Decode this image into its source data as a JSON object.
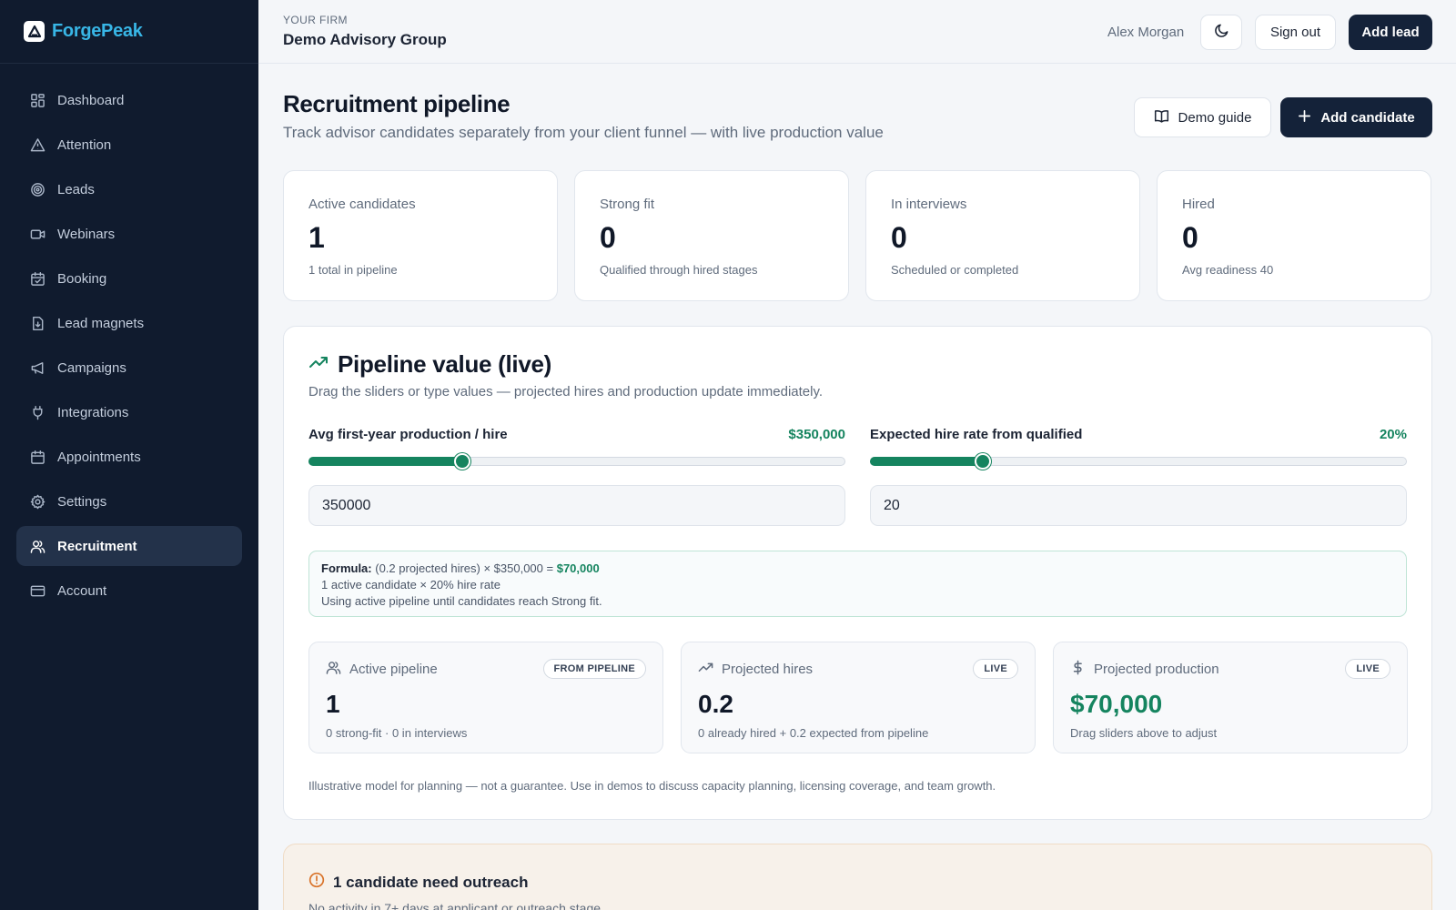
{
  "brand": {
    "name": "ForgePeak"
  },
  "sidebar": {
    "items": [
      {
        "label": "Dashboard",
        "icon": "dashboard-icon"
      },
      {
        "label": "Attention",
        "icon": "warning-icon"
      },
      {
        "label": "Leads",
        "icon": "target-icon"
      },
      {
        "label": "Webinars",
        "icon": "video-icon"
      },
      {
        "label": "Booking",
        "icon": "calendar-check-icon"
      },
      {
        "label": "Lead magnets",
        "icon": "file-download-icon"
      },
      {
        "label": "Campaigns",
        "icon": "megaphone-icon"
      },
      {
        "label": "Integrations",
        "icon": "plug-icon"
      },
      {
        "label": "Appointments",
        "icon": "calendar-icon"
      },
      {
        "label": "Settings",
        "icon": "gear-icon"
      },
      {
        "label": "Recruitment",
        "icon": "users-icon",
        "active": true
      },
      {
        "label": "Account",
        "icon": "credit-card-icon"
      }
    ]
  },
  "topbar": {
    "firm_label": "YOUR FIRM",
    "firm_name": "Demo Advisory Group",
    "user_name": "Alex Morgan",
    "sign_out": "Sign out",
    "add_lead": "Add lead"
  },
  "header": {
    "title": "Recruitment pipeline",
    "subtitle": "Track advisor candidates separately from your client funnel — with live production value",
    "demo_guide": "Demo guide",
    "add_candidate": "Add candidate"
  },
  "stats": [
    {
      "label": "Active candidates",
      "value": "1",
      "sub": "1 total in pipeline"
    },
    {
      "label": "Strong fit",
      "value": "0",
      "sub": "Qualified through hired stages"
    },
    {
      "label": "In interviews",
      "value": "0",
      "sub": "Scheduled or completed"
    },
    {
      "label": "Hired",
      "value": "0",
      "sub": "Avg readiness 40"
    }
  ],
  "pipeline": {
    "title": "Pipeline value (live)",
    "description": "Drag the sliders or type values — projected hires and production update immediately.",
    "production_slider": {
      "label": "Avg first-year production / hire",
      "display": "$350,000",
      "input_value": "350000",
      "fraction": 0.285
    },
    "hire_rate_slider": {
      "label": "Expected hire rate from qualified",
      "display": "20%",
      "input_value": "20",
      "fraction": 0.21
    },
    "formula": {
      "label": "Formula:",
      "expression": "(0.2 projected hires) × $350,000 = ",
      "result": "$70,000",
      "line2": "1 active candidate × 20% hire rate",
      "line3": "Using active pipeline until candidates reach Strong fit."
    },
    "metrics": [
      {
        "label": "Active pipeline",
        "badge": "FROM PIPELINE",
        "value": "1",
        "sub": "0 strong-fit · 0 in interviews",
        "icon": "users-icon"
      },
      {
        "label": "Projected hires",
        "badge": "LIVE",
        "value": "0.2",
        "sub": "0 already hired + 0.2 expected from pipeline",
        "icon": "trending-up-icon"
      },
      {
        "label": "Projected production",
        "badge": "LIVE",
        "value": "$70,000",
        "sub": "Drag sliders above to adjust",
        "icon": "dollar-icon"
      }
    ],
    "disclaimer": "Illustrative model for planning — not a guarantee. Use in demos to discuss capacity planning, licensing coverage, and team growth."
  },
  "outreach": {
    "title": "1 candidate need outreach",
    "subtitle": "No activity in 7+ days at applicant or outreach stage"
  },
  "colors": {
    "accent_green": "#15845f",
    "navy": "#142239",
    "sidebar_bg": "#101b2e",
    "brand_blue": "#38b6e6"
  }
}
